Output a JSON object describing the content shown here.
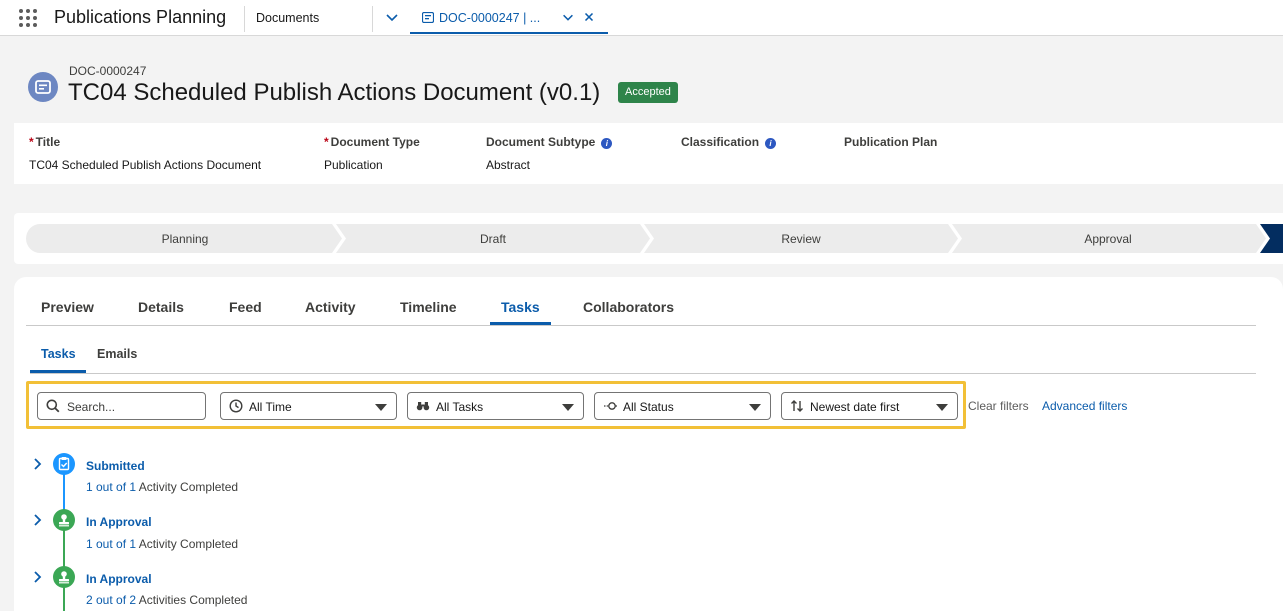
{
  "app": {
    "name": "Publications Planning",
    "nav_item": "Documents",
    "tab_label": "DOC-0000247 | ..."
  },
  "record": {
    "number": "DOC-0000247",
    "title": "TC04 Scheduled Publish Actions Document (v0.1)",
    "status_badge": "Accepted"
  },
  "fields": [
    {
      "label": "Title",
      "required": true,
      "value": "TC04 Scheduled Publish Actions Document"
    },
    {
      "label": "Document Type",
      "required": true,
      "value": "Publication"
    },
    {
      "label": "Document Subtype",
      "info": true,
      "value": "Abstract"
    },
    {
      "label": "Classification",
      "info": true,
      "value": ""
    },
    {
      "label": "Publication Plan",
      "value": ""
    }
  ],
  "path": {
    "stages": [
      "Planning",
      "Draft",
      "Review",
      "Approval"
    ]
  },
  "tabs": {
    "items": [
      "Preview",
      "Details",
      "Feed",
      "Activity",
      "Timeline",
      "Tasks",
      "Collaborators"
    ],
    "active": "Tasks"
  },
  "subtabs": {
    "items": [
      "Tasks",
      "Emails"
    ],
    "active": "Tasks"
  },
  "filters": {
    "search_placeholder": "Search...",
    "time": "All Time",
    "tasks": "All Tasks",
    "status": "All Status",
    "sort": "Newest date first",
    "clear_label": "Clear filters",
    "advanced_label": "Advanced filters"
  },
  "timeline": [
    {
      "title": "Submitted",
      "progress": "1 out of 1",
      "suffix": " Activity Completed",
      "icon": "clipboard-check-icon",
      "color": "#1b96ff"
    },
    {
      "title": "In Approval",
      "progress": "1 out of 1",
      "suffix": " Activity Completed",
      "icon": "approval-stamp-icon",
      "color": "#3ba755"
    },
    {
      "title": "In Approval",
      "progress": "2 out of 2",
      "suffix": " Activities Completed",
      "icon": "approval-stamp-icon",
      "color": "#3ba755"
    }
  ],
  "colors": {
    "brand_blue": "#0b5cab",
    "badge_green": "#2e844a",
    "filter_highlight": "#f2c037"
  }
}
